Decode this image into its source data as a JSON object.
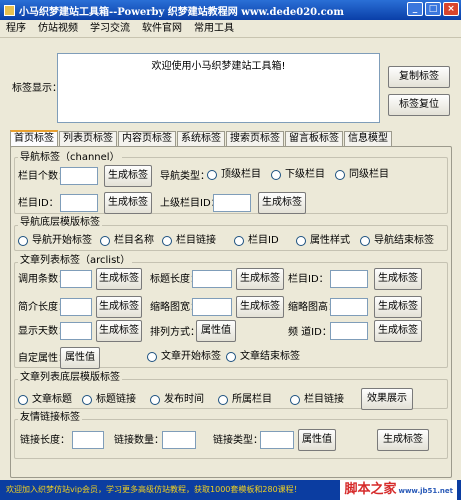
{
  "window": {
    "title": "小马织梦建站工具箱--Powerby 织梦建站教程网 www.dede020.com"
  },
  "menu": [
    "程序",
    "仿站视频",
    "学习交流",
    "软件官网",
    "常用工具"
  ],
  "top": {
    "label_display": "标签显示：",
    "textarea_value": "欢迎使用小马织梦建站工具箱!",
    "copy_button": "复制标签",
    "reset_button": "标签复位"
  },
  "tabs": [
    "首页标签",
    "列表页标签",
    "内容页标签",
    "系统标签",
    "搜索页标签",
    "留言板标签",
    "信息模型"
  ],
  "channel": {
    "title": "导航标签（channel）",
    "count_label": "栏目个数：",
    "gen1": "生成标签",
    "type_label": "导航类型：",
    "radios": [
      "顶级栏目",
      "下级栏目",
      "同级栏目"
    ],
    "id_label": "栏目ID：",
    "gen2": "生成标签",
    "parent_label": "上级栏目ID：",
    "gen3": "生成标签"
  },
  "nav_bottom": {
    "title": "导航底层模版标签",
    "radios": [
      "导航开始标签",
      "栏目名称",
      "栏目链接",
      "栏目ID",
      "属性样式",
      "导航结束标签"
    ]
  },
  "arclist": {
    "title": "文章列表标签（arclist）",
    "call_count": "调用条数：",
    "title_len": "标题长度：",
    "typeid": "栏目ID：",
    "intro_len": "简介长度：",
    "thumb_w": "缩略图宽：",
    "thumb_h": "缩略图高：",
    "days": "显示天数：",
    "order": "排列方式：",
    "attr_btn": "属性值",
    "channel_id": "频  道ID：",
    "custom_attr": "自定属性：",
    "custom_btn": "属性值",
    "gen": "生成标签",
    "radios": [
      "文章开始标签",
      "文章结束标签"
    ]
  },
  "arc_bottom": {
    "title": "文章列表底层模版标签",
    "radios": [
      "文章标题",
      "标题链接",
      "发布时间",
      "所属栏目",
      "栏目链接"
    ],
    "effect_btn": "效果展示"
  },
  "flink": {
    "title": "友情链接标签",
    "len_label": "链接长度：",
    "count_label": "链接数量：",
    "type_label": "链接类型：",
    "attr_btn": "属性值",
    "gen": "生成标签"
  },
  "status": {
    "text": "欢迎加入织梦仿站vip会员，学习更多高级仿站教程，获取1000套模板和280课程！",
    "logo": "脚本之家",
    "logo_sub": "www.jb51.net"
  }
}
